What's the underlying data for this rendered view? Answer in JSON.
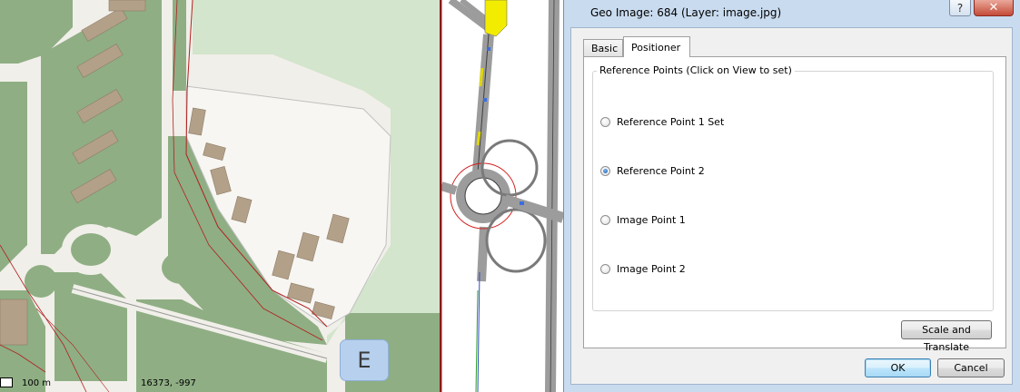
{
  "map": {
    "scale_label": "100 m",
    "coordinates": "16373, -997",
    "marker_label": "E"
  },
  "dialog": {
    "title": "Geo Image: 684 (Layer: image.jpg)",
    "help_label": "?",
    "close_label": "✕",
    "tabs": [
      {
        "label": "Basic",
        "active": false
      },
      {
        "label": "Positioner",
        "active": true
      }
    ],
    "group_title": "Reference Points (Click on View to set)",
    "radios": [
      {
        "label": "Reference Point 1 Set",
        "checked": false
      },
      {
        "label": "Reference Point 2",
        "checked": true
      },
      {
        "label": "Image Point 1",
        "checked": false
      },
      {
        "label": "Image Point 2",
        "checked": false
      }
    ],
    "scale_translate_label": "Scale and Translate",
    "ok_label": "OK",
    "cancel_label": "Cancel"
  },
  "colors": {
    "map_green": "#8fae84",
    "map_light_green": "#d3e5cc",
    "road": "#f1efe9",
    "building": "#b3a089",
    "boundary": "#b22020",
    "dialog_frame": "#c9dbef"
  }
}
